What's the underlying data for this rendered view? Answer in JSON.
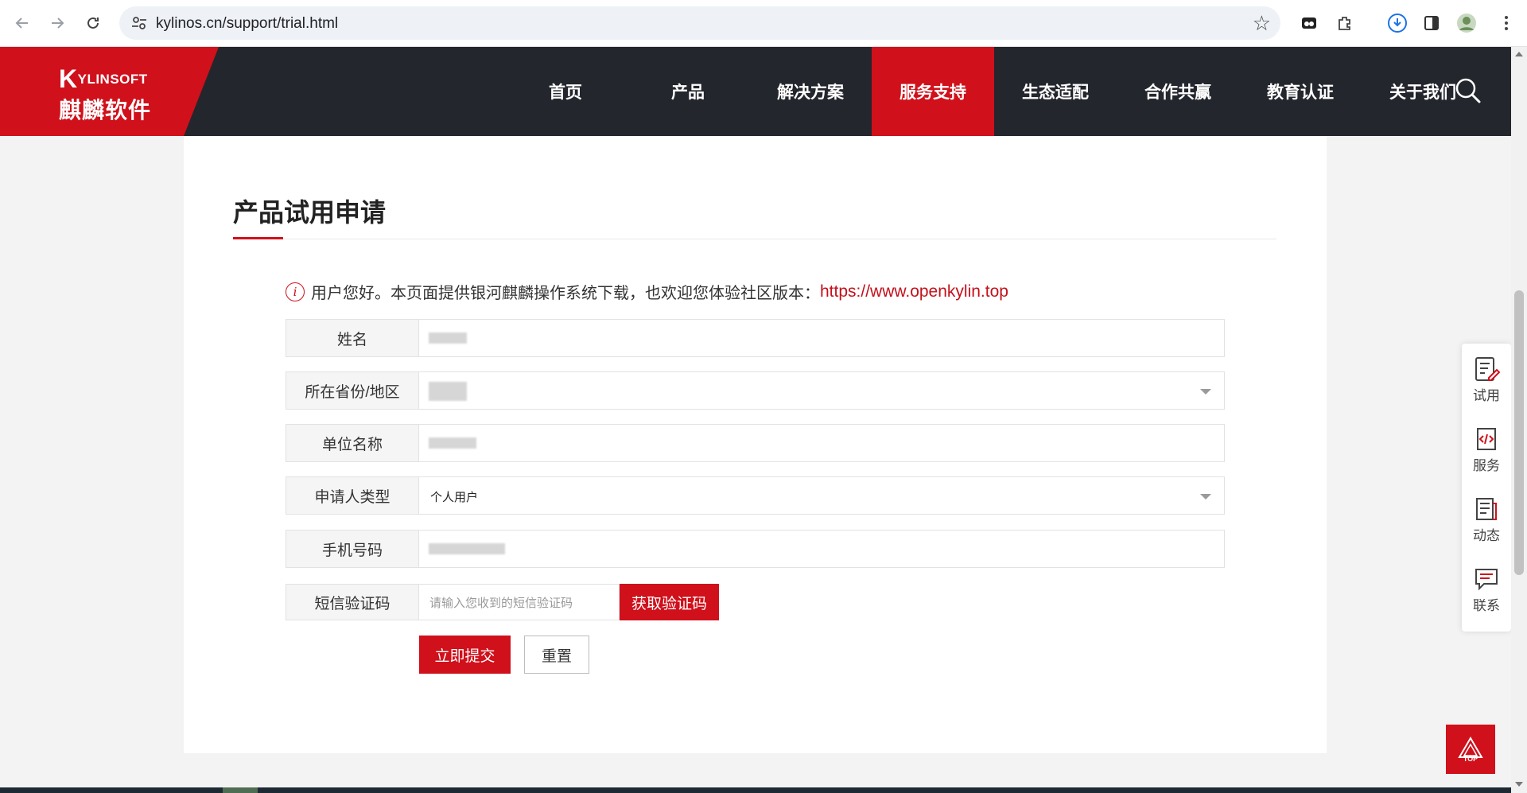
{
  "browser": {
    "url": "kylinos.cn/support/trial.html"
  },
  "header": {
    "logo_en_first": "K",
    "logo_en_rest": "YLINSOFT",
    "logo_cn": "麒麟软件",
    "nav": [
      {
        "label": "首页"
      },
      {
        "label": "产品"
      },
      {
        "label": "解决方案"
      },
      {
        "label": "服务支持"
      },
      {
        "label": "生态适配"
      },
      {
        "label": "合作共赢"
      },
      {
        "label": "教育认证"
      },
      {
        "label": "关于我们"
      }
    ],
    "active_nav": "服务支持"
  },
  "page": {
    "title": "产品试用申请",
    "notice_text": "用户您好。本页面提供银河麒麟操作系统下载，也欢迎您体验社区版本：",
    "notice_link": "https://www.openkylin.top"
  },
  "form": {
    "name_label": "姓名",
    "region_label": "所在省份/地区",
    "org_label": "单位名称",
    "applicant_type_label": "申请人类型",
    "applicant_type_value": "个人用户",
    "phone_label": "手机号码",
    "sms_label": "短信验证码",
    "sms_placeholder": "请输入您收到的短信验证码",
    "sms_button": "获取验证码",
    "submit_button": "立即提交",
    "reset_button": "重置"
  },
  "float_bar": {
    "items": [
      {
        "label": "试用",
        "icon": "trial-icon"
      },
      {
        "label": "服务",
        "icon": "code-service-icon"
      },
      {
        "label": "动态",
        "icon": "news-icon"
      },
      {
        "label": "联系",
        "icon": "chat-icon"
      }
    ],
    "top_label": "TOP"
  },
  "colors": {
    "brand_red": "#d0101b",
    "header_dark": "#24262d"
  }
}
